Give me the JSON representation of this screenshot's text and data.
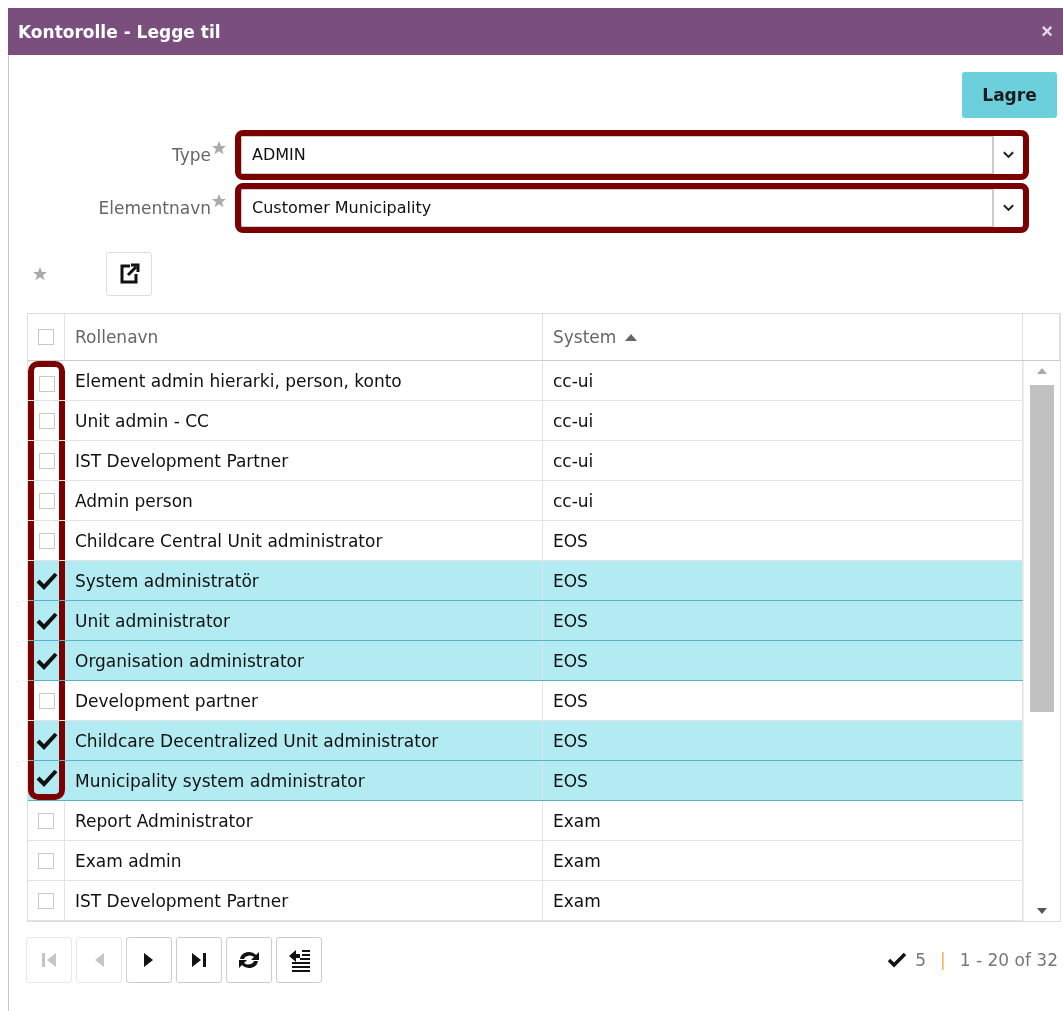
{
  "window": {
    "title": "Kontorolle - Legge til",
    "close": "×"
  },
  "save_button": "Lagre",
  "form": [
    {
      "label": "Type",
      "value": "ADMIN",
      "required": true,
      "highlighted": true
    },
    {
      "label": "Elementnavn",
      "value": "Customer Municipality",
      "required": true,
      "highlighted": true
    }
  ],
  "table": {
    "all_checked": false,
    "columns": [
      {
        "label": "Rollenavn",
        "sorted": false
      },
      {
        "label": "System",
        "sorted": true
      }
    ],
    "rows": [
      {
        "name": "Element admin hierarki, person, konto",
        "system": "cc-ui",
        "selected": false,
        "highlighted": true
      },
      {
        "name": "Unit admin - CC",
        "system": "cc-ui",
        "selected": false,
        "highlighted": true
      },
      {
        "name": "IST Development Partner",
        "system": "cc-ui",
        "selected": false,
        "highlighted": true
      },
      {
        "name": "Admin person",
        "system": "cc-ui",
        "selected": false,
        "highlighted": true
      },
      {
        "name": "Childcare Central Unit administrator",
        "system": "EOS",
        "selected": false,
        "highlighted": true
      },
      {
        "name": "System administratör",
        "system": "EOS",
        "selected": true,
        "highlighted": true
      },
      {
        "name": "Unit administrator",
        "system": "EOS",
        "selected": true,
        "highlighted": true
      },
      {
        "name": "Organisation administrator",
        "system": "EOS",
        "selected": true,
        "highlighted": true
      },
      {
        "name": "Development partner",
        "system": "EOS",
        "selected": false,
        "highlighted": true
      },
      {
        "name": "Childcare Decentralized Unit administrator",
        "system": "EOS",
        "selected": true,
        "highlighted": true
      },
      {
        "name": "Municipality system administrator",
        "system": "EOS",
        "selected": true,
        "highlighted": true
      },
      {
        "name": "Report Administrator",
        "system": "Exam",
        "selected": false,
        "highlighted": false
      },
      {
        "name": "Exam admin",
        "system": "Exam",
        "selected": false,
        "highlighted": false
      },
      {
        "name": "IST Development Partner",
        "system": "Exam",
        "selected": false,
        "highlighted": false
      }
    ]
  },
  "pager": {
    "buttons": [
      {
        "kind": "first",
        "disabled": true
      },
      {
        "kind": "prev",
        "disabled": true
      },
      {
        "kind": "next",
        "disabled": false
      },
      {
        "kind": "last",
        "disabled": false
      },
      {
        "kind": "refresh",
        "disabled": false
      },
      {
        "kind": "columns",
        "disabled": false
      }
    ],
    "selected_count": "5",
    "separator": "|",
    "range": "1 - 20 of 32"
  }
}
